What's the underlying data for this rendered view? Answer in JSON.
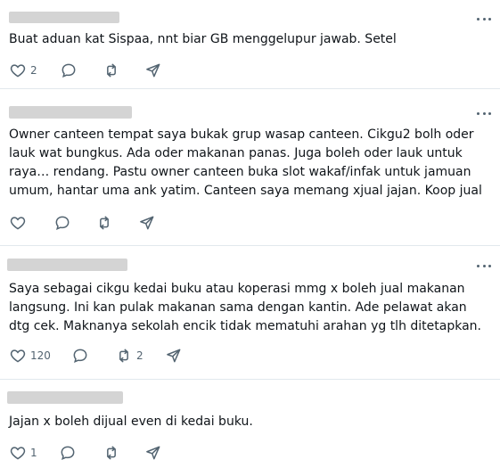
{
  "replies": [
    {
      "text": "Buat aduan kat Sispaa, nnt biar GB menggelupur jawab. Setel",
      "likes": "2",
      "comments": "",
      "reposts": ""
    },
    {
      "text": "Owner canteen tempat saya bukak grup wasap canteen. Cikgu2 bolh oder lauk wat bungkus. Ada oder makanan panas. Juga boleh oder lauk untuk raya… rendang. Pastu owner canteen buka slot wakaf/infak untuk jamuan umum, hantar uma ank yatim. Canteen saya memang xjual jajan. Koop jual",
      "likes": "",
      "comments": "",
      "reposts": ""
    },
    {
      "text": "Saya sebagai cikgu kedai buku atau koperasi mmg x boleh jual makanan langsung. Ini kan pulak makanan sama dengan kantin. Ade pelawat akan dtg cek. Maknanya sekolah encik tidak mematuhi arahan yg tlh ditetapkan.",
      "likes": "120",
      "comments": "",
      "reposts": "2"
    },
    {
      "text": "Jajan x boleh dijual even di kedai buku.",
      "likes": "1",
      "comments": "",
      "reposts": ""
    }
  ],
  "icons": {
    "like": "heart-icon",
    "comment": "speech-bubble-icon",
    "repost": "repost-arrows-icon",
    "share": "send-icon",
    "more": "more-dots-icon"
  }
}
